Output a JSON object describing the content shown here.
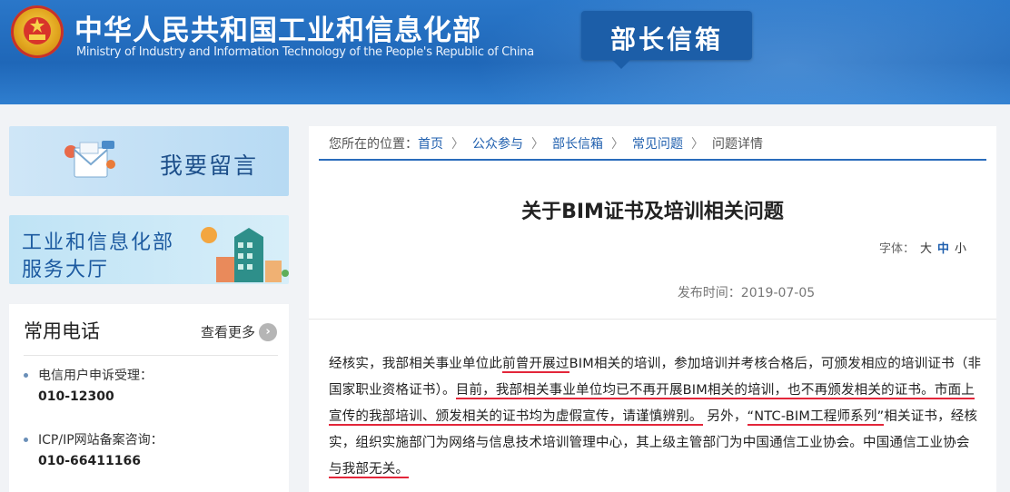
{
  "header": {
    "title_cn": "中华人民共和国工业和信息化部",
    "title_en": "Ministry of Industry and Information Technology of the People's Republic of China",
    "badge": "部长信箱",
    "emblem_icon": "national-emblem-icon"
  },
  "sidebar": {
    "banner_message": "我要留言",
    "banner_service_line1": "工业和信息化部",
    "banner_service_line2": "服务大厅",
    "phones": {
      "heading": "常用电话",
      "more": "查看更多",
      "more_icon": "chevron-right-icon",
      "items": [
        {
          "name": "电信用户申诉受理：",
          "number": "010-12300"
        },
        {
          "name": "ICP/IP网站备案咨询：",
          "number": "010-66411166"
        }
      ]
    }
  },
  "breadcrumb": {
    "prefix": "您所在的位置：",
    "items": [
      "首页",
      "公众参与",
      "部长信箱",
      "常见问题"
    ],
    "current": "问题详情",
    "separator": "〉"
  },
  "article": {
    "title": "关于BIM证书及培训相关问题",
    "font_label": "字体：",
    "font_large": "大",
    "font_medium": "中",
    "font_small": "小",
    "publish_date": "发布时间：2019-07-05",
    "segments": [
      {
        "text": "经核实，我部相关事业单位此",
        "underline": false
      },
      {
        "text": "前曾开展过",
        "underline": true
      },
      {
        "text": "BIM相关的培训，参加培训并考核合格后，可颁发相应的培训证书（非国家职业资格证书）。",
        "underline": false
      },
      {
        "text": "目前，我部相关事业单位均已不再开展BIM相关的培训，也不再颁发相关的证书。市面上宣传的我部培训、颁发相关的证书均为虚假宣传，请谨慎辨别。",
        "underline": true
      },
      {
        "text": " 另外，",
        "underline": false
      },
      {
        "text": "“NTC-BIM工程师系列”",
        "underline": true
      },
      {
        "text": "相关证书，经核实，组织实施部门为网络与信息技术培训管理中心，其上级主管部门为中国通信工业协会。中国通信工业协会",
        "underline": false
      },
      {
        "text": "与我部无关。",
        "underline": true
      }
    ]
  },
  "colors": {
    "header_blue": "#1f67b8",
    "accent_blue": "#2a6cbc",
    "underline_red": "#e3263a"
  }
}
